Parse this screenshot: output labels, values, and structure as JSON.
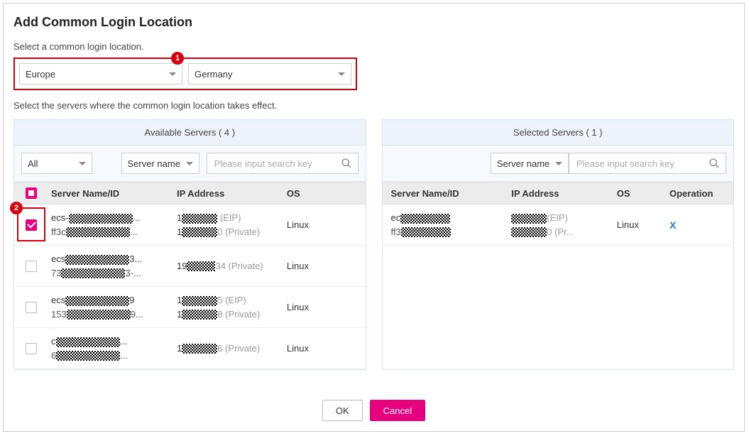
{
  "title": "Add Common Login Location",
  "instructions": {
    "select_loc": "Select a common login location.",
    "select_servers": "Select the servers where the common login location takes effect."
  },
  "location": {
    "region": "Europe",
    "country": "Germany"
  },
  "available": {
    "header": "Available Servers ( 4 )",
    "filter_all": "All",
    "filter_type": "Server name",
    "search_placeholder": "Please input search key",
    "columns": {
      "name": "Server Name/ID",
      "ip": "IP Address",
      "os": "OS"
    },
    "rows": [
      {
        "checked": true,
        "name1": "ecs-",
        "name2": "ff3c",
        "ip1_suffix": " (EIP)",
        "ip2_suffix": "0 (Private)",
        "os": "Linux"
      },
      {
        "checked": false,
        "name1": "ecs",
        "name2": "73",
        "ip1_suffix": "34 (Private)",
        "ip2_suffix": "",
        "os": "Linux"
      },
      {
        "checked": false,
        "name1": "ecs",
        "name2": "153",
        "ip1_suffix": "5 (EIP)",
        "ip2_suffix": "8 (Private)",
        "os": "Linux"
      },
      {
        "checked": false,
        "name1": "c",
        "name2": "6",
        "ip1_suffix": "6 (Private)",
        "ip2_suffix": "",
        "os": "Linux"
      }
    ]
  },
  "selected": {
    "header": "Selected Servers ( 1 )",
    "filter_type": "Server name",
    "search_placeholder": "Please input search key",
    "columns": {
      "name": "Server Name/ID",
      "ip": "IP Address",
      "os": "OS",
      "op": "Operation"
    },
    "rows": [
      {
        "name1": "ec",
        "name2": "ff3",
        "ip1_suffix": "(EIP)",
        "ip2_suffix": "0 (Pr...",
        "os": "Linux",
        "op": "X"
      }
    ]
  },
  "buttons": {
    "ok": "OK",
    "cancel": "Cancel"
  },
  "callouts": {
    "one": "1",
    "two": "2"
  }
}
